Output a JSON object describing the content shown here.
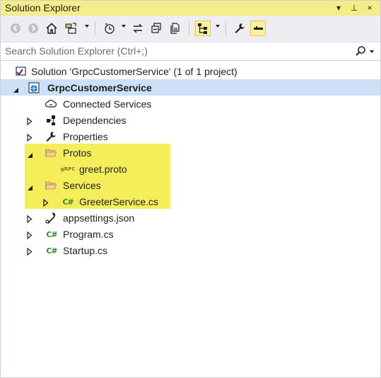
{
  "window": {
    "title": "Solution Explorer",
    "controls": [
      "▾",
      "⊥",
      "×"
    ]
  },
  "search": {
    "placeholder": "Search Solution Explorer (Ctrl+;)"
  },
  "tree": {
    "solution": "Solution 'GrpcCustomerService' (1 of 1 project)",
    "project": "GrpcCustomerService",
    "connected_services": "Connected Services",
    "dependencies": "Dependencies",
    "properties": "Properties",
    "protos": "Protos",
    "greet_proto": "greet.proto",
    "grpc_badge": "gRPC",
    "services": "Services",
    "greeter_service": "GreeterService.cs",
    "appsettings": "appsettings.json",
    "program": "Program.cs",
    "startup": "Startup.cs",
    "csharp_badge": "C#"
  },
  "colors": {
    "title_bar": "#f5ee88",
    "highlight": "#f5ee5a",
    "selection": "#cce0f7",
    "csharp": "#388a34"
  }
}
